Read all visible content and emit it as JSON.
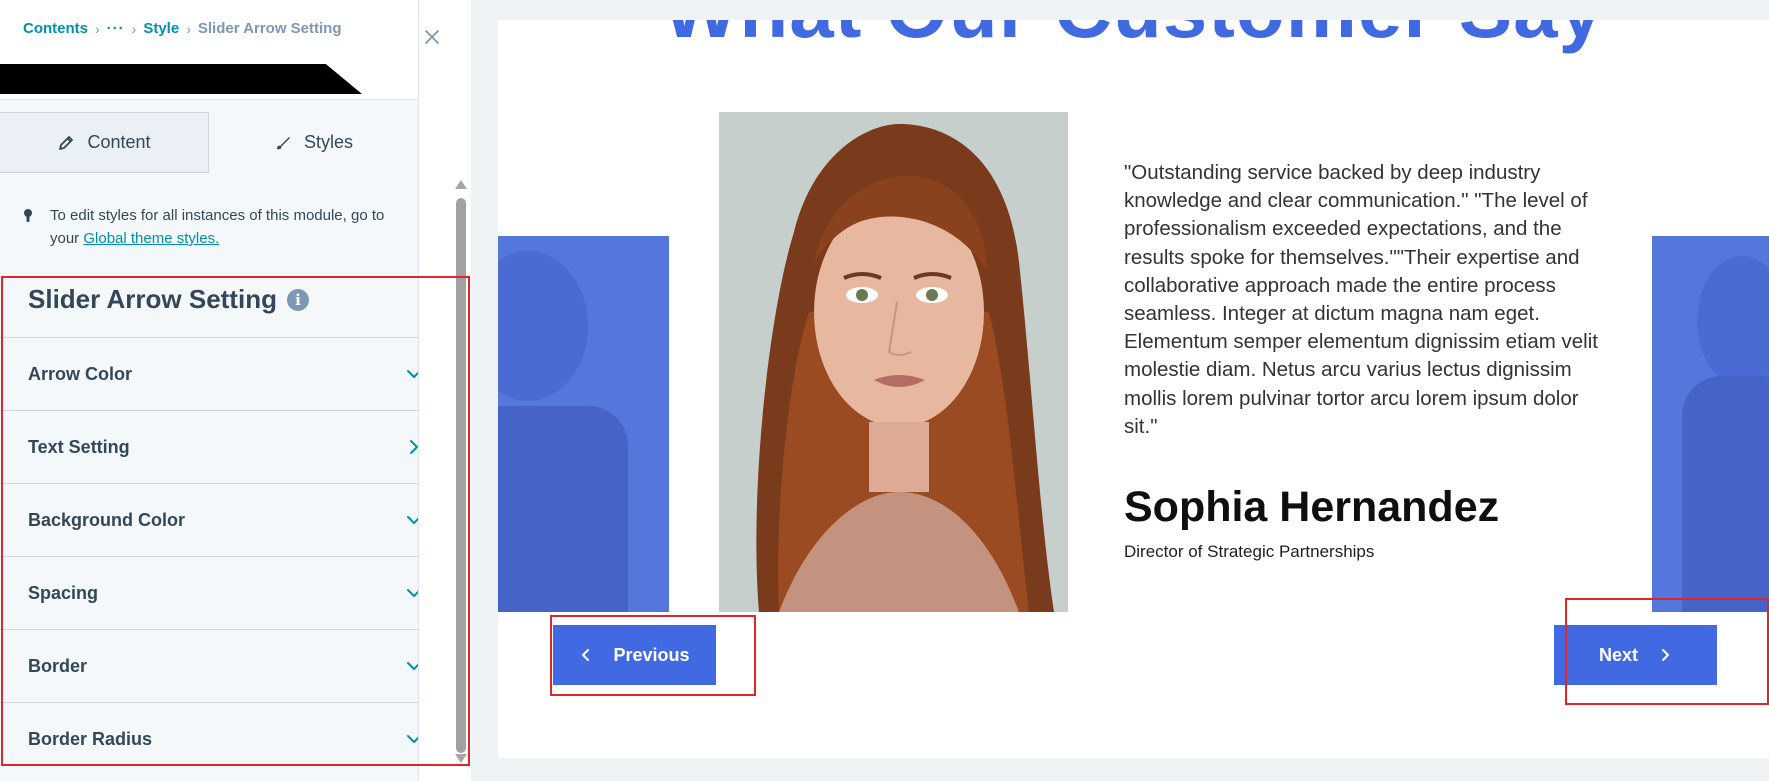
{
  "breadcrumb": {
    "contents": "Contents",
    "ellipsis": "···",
    "style": "Style",
    "current": "Slider Arrow Setting"
  },
  "tabs": {
    "content": "Content",
    "styles": "Styles"
  },
  "info": {
    "text": "To edit styles for all instances of this module, go to your",
    "link": "Global theme styles."
  },
  "section": {
    "title": "Slider Arrow Setting",
    "info_icon": "i"
  },
  "accordion": [
    {
      "label": "Arrow Color",
      "icon": "chevron-down-icon"
    },
    {
      "label": "Text Setting",
      "icon": "chevron-right-icon"
    },
    {
      "label": "Background Color",
      "icon": "chevron-down-icon"
    },
    {
      "label": "Spacing",
      "icon": "chevron-down-icon"
    },
    {
      "label": "Border",
      "icon": "chevron-down-icon"
    },
    {
      "label": "Border Radius",
      "icon": "chevron-down-icon"
    }
  ],
  "preview": {
    "heading": "What Our Customer Say",
    "quote": "\"Outstanding service backed by deep industry knowledge and clear communication.\" \"The level of professionalism exceeded expectations, and the results spoke for themselves.\"\"Their expertise and collaborative approach made the entire process seamless. Integer at dictum magna nam eget. Elementum semper elementum dignissim etiam velit molestie diam. Netus arcu varius lectus dignissim mollis lorem pulvinar tortor arcu lorem ipsum dolor sit.\"",
    "name": "Sophia Hernandez",
    "role": "Director of Strategic Partnerships",
    "prev_label": "Previous",
    "next_label": "Next"
  },
  "colors": {
    "accent": "#4169e1",
    "link": "#0091ae",
    "text": "#33475b",
    "highlight": "#e0262a"
  }
}
